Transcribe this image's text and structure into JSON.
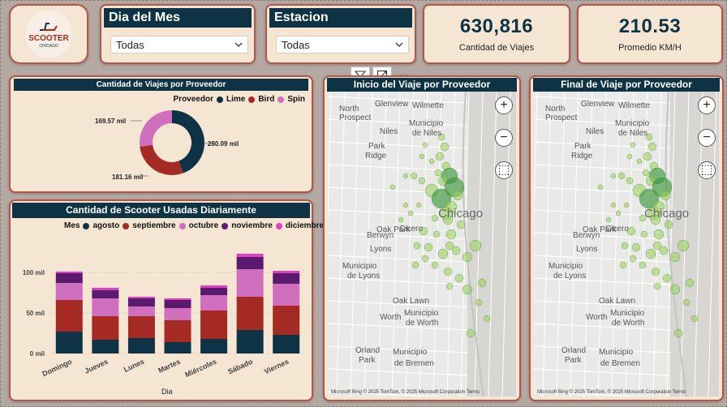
{
  "logo": {
    "text_top": "SCOOTER",
    "text_bottom": "CHICAGO"
  },
  "slicers": [
    {
      "title": "Dia del Mes",
      "value": "Todas"
    },
    {
      "title": "Estacion",
      "value": "Todas"
    }
  ],
  "kpis": [
    {
      "value": "630,816",
      "label": "Cantidad de Viajes"
    },
    {
      "value": "210.53",
      "label": "Promedio KM/H"
    }
  ],
  "donut": {
    "title": "Cantidad de Viajes por Proveedor",
    "legend_title": "Proveedor",
    "labels": {
      "lime": "280.09 mil",
      "bird": "181.16 mil",
      "spin": "169.57 mil"
    }
  },
  "bar": {
    "title": "Cantidad de Scooter Usadas Diariamente",
    "legend_title": "Mes",
    "xlabel": "Dia",
    "yticks": [
      "100 mil",
      "50 mil",
      "0 mil"
    ]
  },
  "maps": [
    {
      "title": "Inicio del Viaje por Proveedor"
    },
    {
      "title": "Final de Viaje por Proveedor"
    }
  ],
  "map_labels": {
    "north": "North",
    "prospect": "Prospect",
    "glenview": "Glenview",
    "wilmette": "Wilmette",
    "municipio_niles": "Municipio",
    "de_niles": "de Niles",
    "niles": "Niles",
    "park": "Park",
    "ridge": "Ridge",
    "chicago": "Chicago",
    "oak_park": "Oak Park",
    "cicero": "Cicero",
    "berwyn": "Berwyn",
    "lyons": "Lyons",
    "municipio_lyons": "Municipio",
    "de_lyons": "de Lyons",
    "oak_lawn": "Oak Lawn",
    "worth": "Worth",
    "municipio_worth": "Municipio",
    "de_worth": "de Worth",
    "orland": "Orland",
    "park2": "Park",
    "municipio_bremen": "Municipio",
    "de_bremen": "de Bremen",
    "footer": "Microsoft Bing   © 2025 TomTom, © 2025 Microsoft Corporation  Terms"
  },
  "toolbar": {
    "filter": "filter-icon",
    "focus": "focus-mode-icon",
    "more": "more-options-icon"
  },
  "chart_data": [
    {
      "type": "pie",
      "title": "Cantidad de Viajes por Proveedor",
      "categories": [
        "Lime",
        "Bird",
        "Spin"
      ],
      "values": [
        280.09,
        181.16,
        169.57
      ],
      "colors": [
        "#0e3345",
        "#a52a23",
        "#d06fbd"
      ],
      "unit": "mil",
      "legend": "top-right"
    },
    {
      "type": "bar",
      "stacked": true,
      "title": "Cantidad de Scooter Usadas Diariamente",
      "xlabel": "Dia",
      "ylabel": "",
      "categories": [
        "Domingo",
        "Jueves",
        "Lunes",
        "Martes",
        "Miércoles",
        "Sábado",
        "Viernes"
      ],
      "ylim": [
        0,
        125
      ],
      "series": [
        {
          "name": "agosto",
          "color": "#0e3345",
          "values": [
            27,
            17,
            19,
            14,
            18,
            29,
            23
          ]
        },
        {
          "name": "septiembre",
          "color": "#a52a23",
          "values": [
            39,
            29,
            27,
            27,
            35,
            41,
            36
          ]
        },
        {
          "name": "octubre",
          "color": "#d06fbd",
          "values": [
            21,
            22,
            12,
            15,
            19,
            34,
            27
          ]
        },
        {
          "name": "noviembre",
          "color": "#5a1a6e",
          "values": [
            12,
            10,
            10,
            10,
            9,
            15,
            13
          ]
        },
        {
          "name": "diciembre",
          "color": "#e040c0",
          "values": [
            2,
            3,
            2,
            2,
            3,
            4,
            3
          ]
        }
      ],
      "legend": "top"
    }
  ]
}
